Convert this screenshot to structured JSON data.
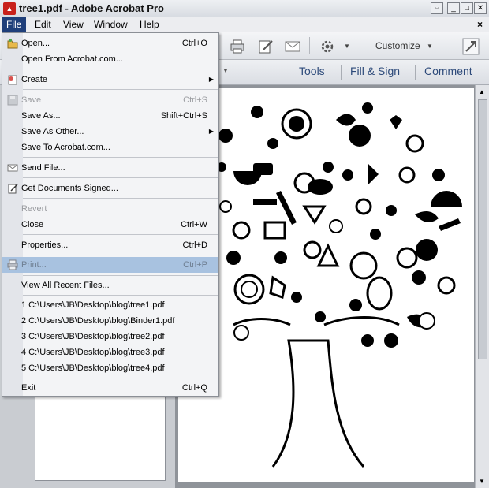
{
  "window": {
    "title": "tree1.pdf - Adobe Acrobat Pro"
  },
  "menubar": {
    "items": [
      "File",
      "Edit",
      "View",
      "Window",
      "Help"
    ],
    "close_doc": "×"
  },
  "toolbar": {
    "customize_label": "Customize",
    "tools": "Tools",
    "fill_sign": "Fill & Sign",
    "comment": "Comment"
  },
  "file_menu": {
    "items": [
      {
        "label": "Open...",
        "shortcut": "Ctrl+O"
      },
      {
        "label": "Open From Acrobat.com...",
        "shortcut": ""
      },
      {
        "label": "Create",
        "shortcut": ""
      },
      {
        "label": "Save",
        "shortcut": "Ctrl+S"
      },
      {
        "label": "Save As...",
        "shortcut": "Shift+Ctrl+S"
      },
      {
        "label": "Save As Other...",
        "shortcut": ""
      },
      {
        "label": "Save To Acrobat.com...",
        "shortcut": ""
      },
      {
        "label": "Send File...",
        "shortcut": ""
      },
      {
        "label": "Get Documents Signed...",
        "shortcut": ""
      },
      {
        "label": "Revert",
        "shortcut": ""
      },
      {
        "label": "Close",
        "shortcut": "Ctrl+W"
      },
      {
        "label": "Properties...",
        "shortcut": "Ctrl+D"
      },
      {
        "label": "Print...",
        "shortcut": "Ctrl+P"
      },
      {
        "label": "View All Recent Files...",
        "shortcut": ""
      },
      {
        "label": "1 C:\\Users\\JB\\Desktop\\blog\\tree1.pdf",
        "shortcut": ""
      },
      {
        "label": "2 C:\\Users\\JB\\Desktop\\blog\\Binder1.pdf",
        "shortcut": ""
      },
      {
        "label": "3 C:\\Users\\JB\\Desktop\\blog\\tree2.pdf",
        "shortcut": ""
      },
      {
        "label": "4 C:\\Users\\JB\\Desktop\\blog\\tree3.pdf",
        "shortcut": ""
      },
      {
        "label": "5 C:\\Users\\JB\\Desktop\\blog\\tree4.pdf",
        "shortcut": ""
      },
      {
        "label": "Exit",
        "shortcut": "Ctrl+Q"
      }
    ]
  },
  "colors": {
    "menu_active": "#1f3f7a",
    "highlight": "#a8c2e0",
    "link": "#2d4a7a"
  }
}
